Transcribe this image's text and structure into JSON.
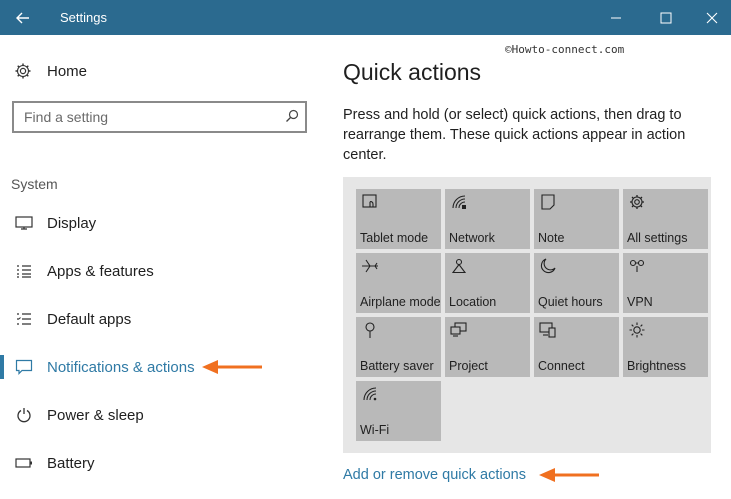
{
  "window": {
    "title": "Settings"
  },
  "titlebar_icons": [
    "back-arrow-icon",
    "minimize-icon",
    "maximize-icon",
    "close-icon"
  ],
  "sidebar": {
    "home_label": "Home",
    "search_placeholder": "Find a setting",
    "group_label": "System",
    "items": [
      {
        "label": "Display",
        "icon": "monitor-icon",
        "active": false
      },
      {
        "label": "Apps & features",
        "icon": "list-icon",
        "active": false
      },
      {
        "label": "Default apps",
        "icon": "default-apps-icon",
        "active": false
      },
      {
        "label": "Notifications & actions",
        "icon": "notification-icon",
        "active": true
      },
      {
        "label": "Power & sleep",
        "icon": "power-icon",
        "active": false
      },
      {
        "label": "Battery",
        "icon": "battery-icon",
        "active": false
      }
    ]
  },
  "main": {
    "watermark": "©Howto-connect.com",
    "title": "Quick actions",
    "description": "Press and hold (or select) quick actions, then drag to rearrange them. These quick actions appear in action center.",
    "tiles": [
      {
        "label": "Tablet mode",
        "icon": "tablet-mode-icon"
      },
      {
        "label": "Network",
        "icon": "network-icon"
      },
      {
        "label": "Note",
        "icon": "note-icon"
      },
      {
        "label": "All settings",
        "icon": "gear-icon"
      },
      {
        "label": "Airplane mode",
        "icon": "airplane-icon"
      },
      {
        "label": "Location",
        "icon": "location-icon"
      },
      {
        "label": "Quiet hours",
        "icon": "moon-icon"
      },
      {
        "label": "VPN",
        "icon": "vpn-icon"
      },
      {
        "label": "Battery saver",
        "icon": "battery-saver-icon"
      },
      {
        "label": "Project",
        "icon": "project-icon"
      },
      {
        "label": "Connect",
        "icon": "connect-icon"
      },
      {
        "label": "Brightness",
        "icon": "brightness-icon"
      },
      {
        "label": "Wi-Fi",
        "icon": "wifi-icon"
      }
    ],
    "add_remove_link": "Add or remove quick actions"
  },
  "colors": {
    "titlebar": "#2b6a8f",
    "accent": "#2f7aa5",
    "tile": "#b9b9b9",
    "panel": "#e6e6e6",
    "annotation_arrow": "#f07020"
  }
}
